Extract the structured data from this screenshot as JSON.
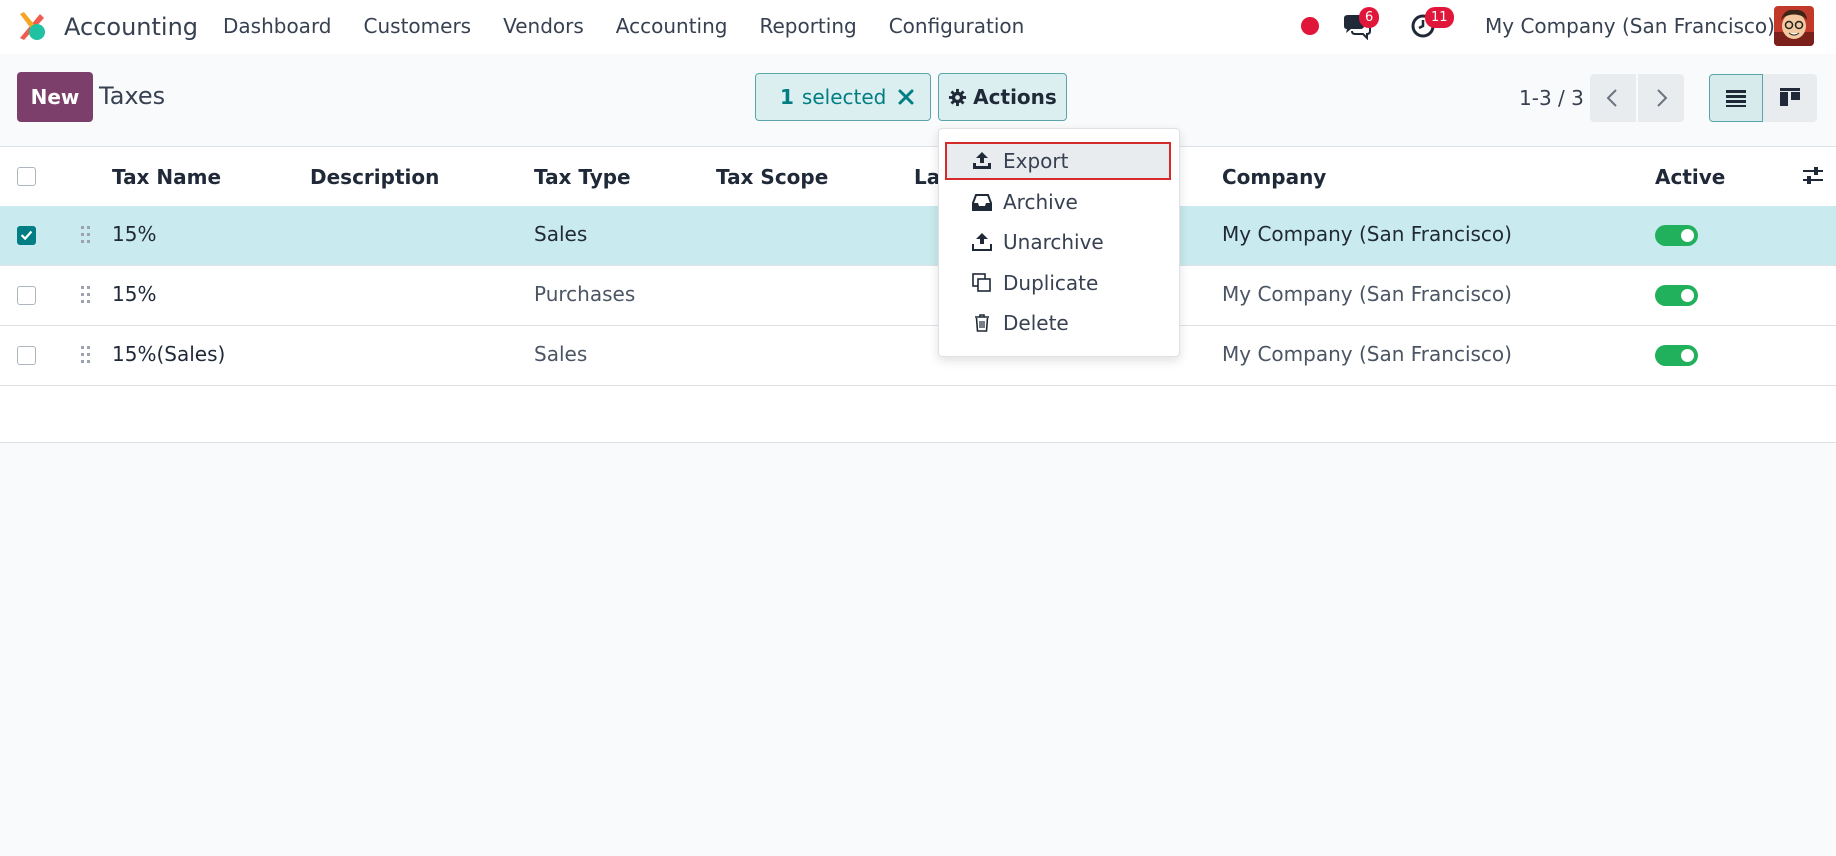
{
  "navbar": {
    "app_name": "Accounting",
    "menu": [
      "Dashboard",
      "Customers",
      "Vendors",
      "Accounting",
      "Reporting",
      "Configuration"
    ],
    "messages_count": "6",
    "activities_count": "11",
    "company": "My Company (San Francisco)"
  },
  "control_panel": {
    "new_label": "New",
    "title": "Taxes",
    "selected_count": "1",
    "selected_label": "selected",
    "actions_label": "Actions",
    "pager": "1-3 / 3"
  },
  "table": {
    "columns": [
      "Tax Name",
      "Description",
      "Tax Type",
      "Tax Scope",
      "La",
      "Company",
      "Active"
    ],
    "rows": [
      {
        "name": "15%",
        "type": "Sales",
        "company": "My Company (San Francisco)",
        "active": true,
        "selected": true
      },
      {
        "name": "15%",
        "type": "Purchases",
        "company": "My Company (San Francisco)",
        "active": true,
        "selected": false
      },
      {
        "name": "15%(Sales)",
        "type": "Sales",
        "company": "My Company (San Francisco)",
        "active": true,
        "selected": false
      }
    ]
  },
  "actions_menu": {
    "items": [
      {
        "label": "Export",
        "icon": "upload-icon"
      },
      {
        "label": "Archive",
        "icon": "inbox-icon"
      },
      {
        "label": "Unarchive",
        "icon": "upload-outline-icon"
      },
      {
        "label": "Duplicate",
        "icon": "copy-icon"
      },
      {
        "label": "Delete",
        "icon": "trash-icon"
      }
    ]
  },
  "colors": {
    "brand": "#7c3f6b",
    "accent": "#017e84",
    "selected_row": "#c9eaee",
    "toggle_on": "#21b05b",
    "badge": "#e0163a"
  }
}
